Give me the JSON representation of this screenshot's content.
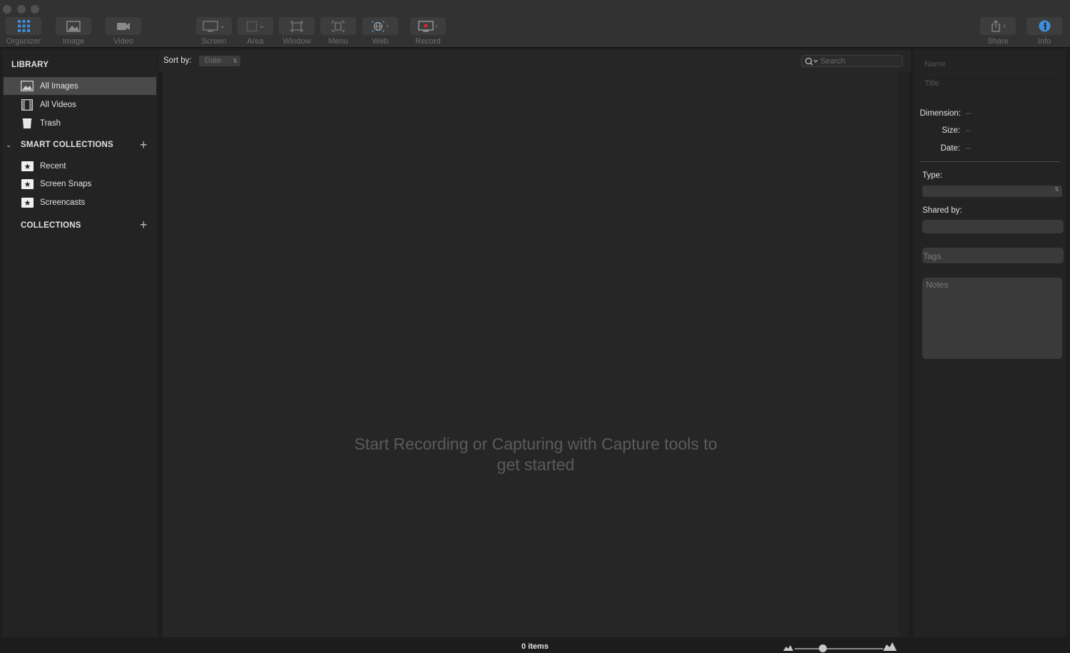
{
  "toolbar": {
    "organizer": "Organizer",
    "image": "Image",
    "video": "Video",
    "screen": "Screen",
    "area": "Area",
    "window": "Window",
    "menu": "Menu",
    "web": "Web",
    "record": "Record",
    "share": "Share",
    "info": "Info"
  },
  "sidebar": {
    "library_title": "LIBRARY",
    "library_items": [
      {
        "label": "All Images",
        "icon": "image-icon",
        "selected": true
      },
      {
        "label": "All Videos",
        "icon": "film-icon"
      },
      {
        "label": "Trash",
        "icon": "trash-icon"
      }
    ],
    "smart_title": "SMART COLLECTIONS",
    "smart_items": [
      {
        "label": "Recent",
        "icon": "star-folder-icon"
      },
      {
        "label": "Screen Snaps",
        "icon": "star-folder-icon"
      },
      {
        "label": "Screencasts",
        "icon": "star-folder-icon"
      }
    ],
    "collections_title": "COLLECTIONS"
  },
  "sortbar": {
    "sort_label": "Sort by:",
    "sort_value": "Date",
    "search_placeholder": "Search"
  },
  "main": {
    "empty_line1": "Start Recording or Capturing with Capture tools to",
    "empty_line2": "get started"
  },
  "inspector": {
    "name_placeholder": "Name",
    "title_placeholder": "Title",
    "dimension_label": "Dimension:",
    "dimension_value": "--",
    "size_label": "Size:",
    "size_value": "--",
    "date_label": "Date:",
    "date_value": "--",
    "type_label": "Type:",
    "shared_label": "Shared by:",
    "tags_placeholder": "Tags",
    "notes_placeholder": "Notes"
  },
  "status": {
    "item_count": "0 items"
  },
  "colors": {
    "accent_blue": "#3e8ede",
    "record_red": "#d8262b"
  }
}
